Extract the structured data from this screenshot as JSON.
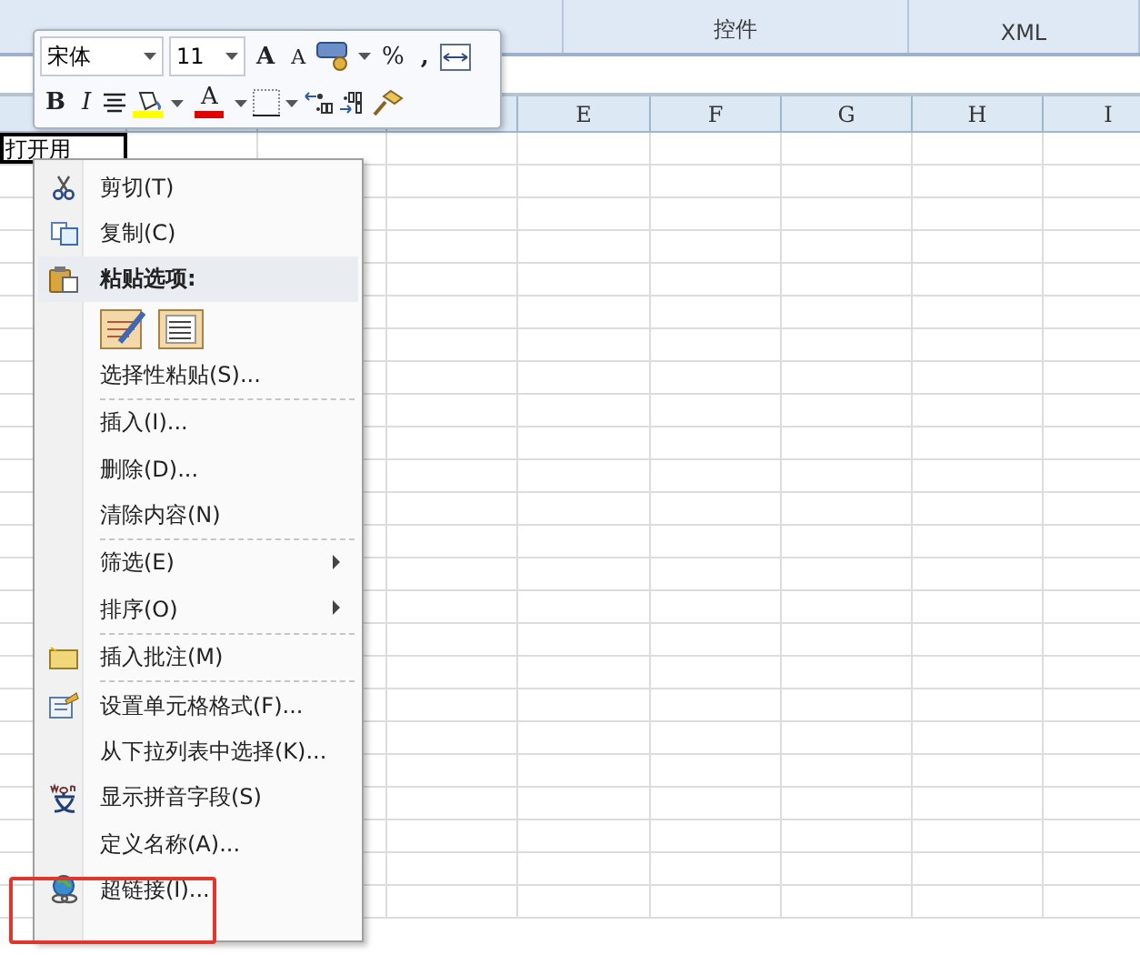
{
  "ribbon": {
    "groups": [
      {
        "label": "控件"
      },
      {
        "label": "XML"
      }
    ]
  },
  "sheet": {
    "columns": [
      "",
      "",
      "",
      "",
      "E",
      "F",
      "G",
      "H",
      "I"
    ],
    "cell_a1": "打开用"
  },
  "mini_toolbar": {
    "font_name": "宋体",
    "font_size": "11",
    "grow_label": "A",
    "shrink_label": "A",
    "percent": "%",
    "comma": ",",
    "bold": "B",
    "italic": "I",
    "font_color_label": "A"
  },
  "context_menu": {
    "items": [
      {
        "kind": "item",
        "label": "剪切(T)"
      },
      {
        "kind": "item",
        "label": "复制(C)"
      },
      {
        "kind": "header",
        "label": "粘贴选项:"
      },
      {
        "kind": "paste-options"
      },
      {
        "kind": "item",
        "label": "选择性粘贴(S)..."
      },
      {
        "kind": "separator"
      },
      {
        "kind": "item",
        "label": "插入(I)..."
      },
      {
        "kind": "item",
        "label": "删除(D)..."
      },
      {
        "kind": "item",
        "label": "清除内容(N)"
      },
      {
        "kind": "separator"
      },
      {
        "kind": "item",
        "label": "筛选(E)",
        "submenu": true
      },
      {
        "kind": "item",
        "label": "排序(O)",
        "submenu": true
      },
      {
        "kind": "separator"
      },
      {
        "kind": "item",
        "label": "插入批注(M)"
      },
      {
        "kind": "separator"
      },
      {
        "kind": "item",
        "label": "设置单元格格式(F)..."
      },
      {
        "kind": "item",
        "label": "从下拉列表中选择(K)..."
      },
      {
        "kind": "item",
        "label": "显示拼音字段(S)"
      },
      {
        "kind": "item",
        "label": "定义名称(A)..."
      },
      {
        "kind": "item",
        "label": "超链接(I)...",
        "highlighted": true
      }
    ]
  }
}
